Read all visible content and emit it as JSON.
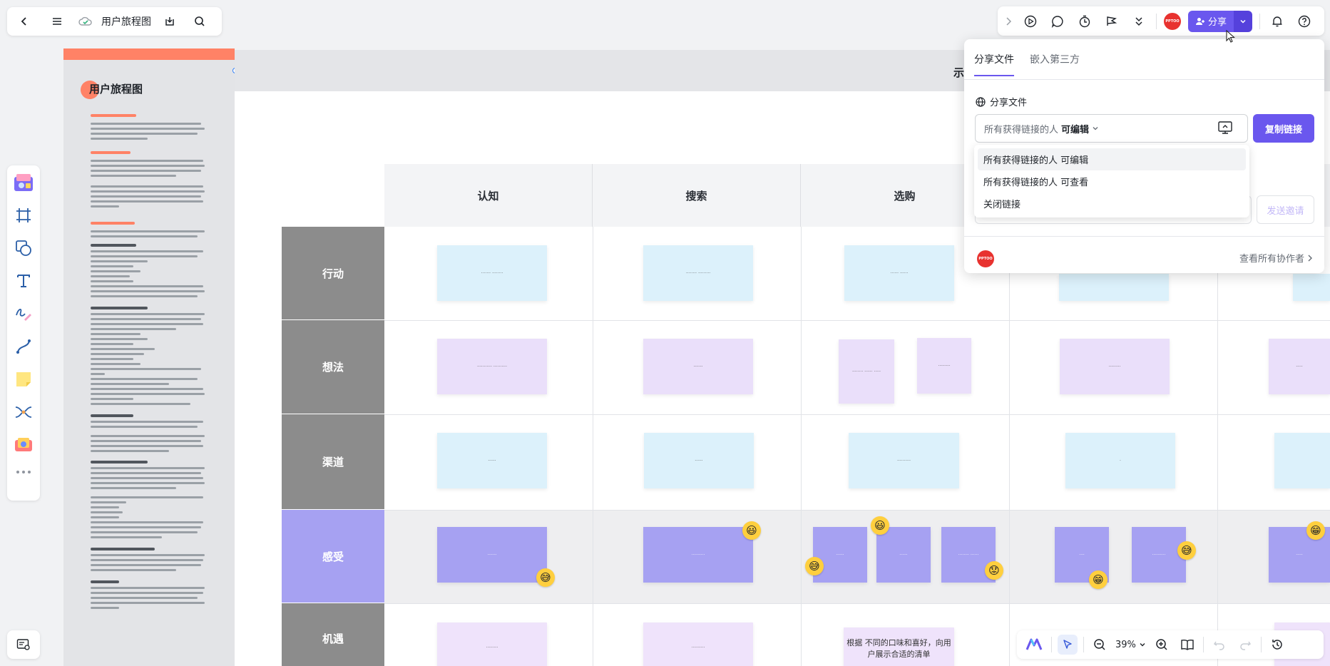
{
  "app": {
    "doc_title": "用户旅程图",
    "colors": {
      "accent": "#6a57ee",
      "orange": "#ff8266",
      "red_avatar": "#e8322f"
    }
  },
  "toolbar_left": {
    "icons": [
      "back-icon",
      "menu-icon",
      "cloud-icon",
      "download-icon",
      "search-icon"
    ]
  },
  "toolbar_right": {
    "icons": [
      "chevron-right-icon",
      "play-icon",
      "comment-icon",
      "timer-icon",
      "flag-icon",
      "double-chevron-down-icon",
      "bell-icon",
      "help-icon"
    ],
    "avatar_text": "PPTOO",
    "share_label": "分享"
  },
  "document_panel": {
    "title": "用户旅程图"
  },
  "board": {
    "columns": [
      "认知",
      "搜索",
      "选购"
    ],
    "rows": [
      "行动",
      "想法",
      "渠道",
      "感受",
      "机遇"
    ],
    "partial_header": "示",
    "opportunity_note": "根据 不同的口味和喜好，向用户展示合适的清单"
  },
  "share_panel": {
    "tabs": [
      "分享文件",
      "嵌入第三方"
    ],
    "active_tab": 0,
    "section_title": "分享文件",
    "permission_prefix": "所有获得链接的人",
    "permission_value": "可编辑",
    "copy_label": "复制链接",
    "invite_label": "发送邀请",
    "options": [
      "所有获得链接的人 可编辑",
      "所有获得链接的人 可查看",
      "关闭链接"
    ],
    "view_all_label": "查看所有协作者"
  },
  "bottom_toolbar": {
    "zoom": "39%"
  }
}
